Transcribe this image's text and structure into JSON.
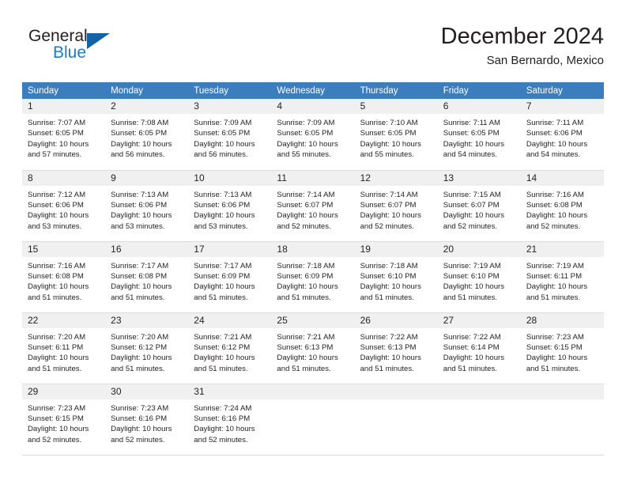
{
  "brand": {
    "general": "General",
    "blue": "Blue",
    "triangle_color": "#1362a4"
  },
  "header": {
    "month_title": "December 2024",
    "location": "San Bernardo, Mexico"
  },
  "theme": {
    "header_blue": "#3c7ebd",
    "daynum_gray": "#f0f0f0",
    "rule_blue": "#1362a4",
    "text": "#231f20"
  },
  "weekdays": [
    "Sunday",
    "Monday",
    "Tuesday",
    "Wednesday",
    "Thursday",
    "Friday",
    "Saturday"
  ],
  "weeks": [
    [
      {
        "day": "1",
        "sunrise": "Sunrise: 7:07 AM",
        "sunset": "Sunset: 6:05 PM",
        "daylight1": "Daylight: 10 hours",
        "daylight2": "and 57 minutes."
      },
      {
        "day": "2",
        "sunrise": "Sunrise: 7:08 AM",
        "sunset": "Sunset: 6:05 PM",
        "daylight1": "Daylight: 10 hours",
        "daylight2": "and 56 minutes."
      },
      {
        "day": "3",
        "sunrise": "Sunrise: 7:09 AM",
        "sunset": "Sunset: 6:05 PM",
        "daylight1": "Daylight: 10 hours",
        "daylight2": "and 56 minutes."
      },
      {
        "day": "4",
        "sunrise": "Sunrise: 7:09 AM",
        "sunset": "Sunset: 6:05 PM",
        "daylight1": "Daylight: 10 hours",
        "daylight2": "and 55 minutes."
      },
      {
        "day": "5",
        "sunrise": "Sunrise: 7:10 AM",
        "sunset": "Sunset: 6:05 PM",
        "daylight1": "Daylight: 10 hours",
        "daylight2": "and 55 minutes."
      },
      {
        "day": "6",
        "sunrise": "Sunrise: 7:11 AM",
        "sunset": "Sunset: 6:05 PM",
        "daylight1": "Daylight: 10 hours",
        "daylight2": "and 54 minutes."
      },
      {
        "day": "7",
        "sunrise": "Sunrise: 7:11 AM",
        "sunset": "Sunset: 6:06 PM",
        "daylight1": "Daylight: 10 hours",
        "daylight2": "and 54 minutes."
      }
    ],
    [
      {
        "day": "8",
        "sunrise": "Sunrise: 7:12 AM",
        "sunset": "Sunset: 6:06 PM",
        "daylight1": "Daylight: 10 hours",
        "daylight2": "and 53 minutes."
      },
      {
        "day": "9",
        "sunrise": "Sunrise: 7:13 AM",
        "sunset": "Sunset: 6:06 PM",
        "daylight1": "Daylight: 10 hours",
        "daylight2": "and 53 minutes."
      },
      {
        "day": "10",
        "sunrise": "Sunrise: 7:13 AM",
        "sunset": "Sunset: 6:06 PM",
        "daylight1": "Daylight: 10 hours",
        "daylight2": "and 53 minutes."
      },
      {
        "day": "11",
        "sunrise": "Sunrise: 7:14 AM",
        "sunset": "Sunset: 6:07 PM",
        "daylight1": "Daylight: 10 hours",
        "daylight2": "and 52 minutes."
      },
      {
        "day": "12",
        "sunrise": "Sunrise: 7:14 AM",
        "sunset": "Sunset: 6:07 PM",
        "daylight1": "Daylight: 10 hours",
        "daylight2": "and 52 minutes."
      },
      {
        "day": "13",
        "sunrise": "Sunrise: 7:15 AM",
        "sunset": "Sunset: 6:07 PM",
        "daylight1": "Daylight: 10 hours",
        "daylight2": "and 52 minutes."
      },
      {
        "day": "14",
        "sunrise": "Sunrise: 7:16 AM",
        "sunset": "Sunset: 6:08 PM",
        "daylight1": "Daylight: 10 hours",
        "daylight2": "and 52 minutes."
      }
    ],
    [
      {
        "day": "15",
        "sunrise": "Sunrise: 7:16 AM",
        "sunset": "Sunset: 6:08 PM",
        "daylight1": "Daylight: 10 hours",
        "daylight2": "and 51 minutes."
      },
      {
        "day": "16",
        "sunrise": "Sunrise: 7:17 AM",
        "sunset": "Sunset: 6:08 PM",
        "daylight1": "Daylight: 10 hours",
        "daylight2": "and 51 minutes."
      },
      {
        "day": "17",
        "sunrise": "Sunrise: 7:17 AM",
        "sunset": "Sunset: 6:09 PM",
        "daylight1": "Daylight: 10 hours",
        "daylight2": "and 51 minutes."
      },
      {
        "day": "18",
        "sunrise": "Sunrise: 7:18 AM",
        "sunset": "Sunset: 6:09 PM",
        "daylight1": "Daylight: 10 hours",
        "daylight2": "and 51 minutes."
      },
      {
        "day": "19",
        "sunrise": "Sunrise: 7:18 AM",
        "sunset": "Sunset: 6:10 PM",
        "daylight1": "Daylight: 10 hours",
        "daylight2": "and 51 minutes."
      },
      {
        "day": "20",
        "sunrise": "Sunrise: 7:19 AM",
        "sunset": "Sunset: 6:10 PM",
        "daylight1": "Daylight: 10 hours",
        "daylight2": "and 51 minutes."
      },
      {
        "day": "21",
        "sunrise": "Sunrise: 7:19 AM",
        "sunset": "Sunset: 6:11 PM",
        "daylight1": "Daylight: 10 hours",
        "daylight2": "and 51 minutes."
      }
    ],
    [
      {
        "day": "22",
        "sunrise": "Sunrise: 7:20 AM",
        "sunset": "Sunset: 6:11 PM",
        "daylight1": "Daylight: 10 hours",
        "daylight2": "and 51 minutes."
      },
      {
        "day": "23",
        "sunrise": "Sunrise: 7:20 AM",
        "sunset": "Sunset: 6:12 PM",
        "daylight1": "Daylight: 10 hours",
        "daylight2": "and 51 minutes."
      },
      {
        "day": "24",
        "sunrise": "Sunrise: 7:21 AM",
        "sunset": "Sunset: 6:12 PM",
        "daylight1": "Daylight: 10 hours",
        "daylight2": "and 51 minutes."
      },
      {
        "day": "25",
        "sunrise": "Sunrise: 7:21 AM",
        "sunset": "Sunset: 6:13 PM",
        "daylight1": "Daylight: 10 hours",
        "daylight2": "and 51 minutes."
      },
      {
        "day": "26",
        "sunrise": "Sunrise: 7:22 AM",
        "sunset": "Sunset: 6:13 PM",
        "daylight1": "Daylight: 10 hours",
        "daylight2": "and 51 minutes."
      },
      {
        "day": "27",
        "sunrise": "Sunrise: 7:22 AM",
        "sunset": "Sunset: 6:14 PM",
        "daylight1": "Daylight: 10 hours",
        "daylight2": "and 51 minutes."
      },
      {
        "day": "28",
        "sunrise": "Sunrise: 7:23 AM",
        "sunset": "Sunset: 6:15 PM",
        "daylight1": "Daylight: 10 hours",
        "daylight2": "and 51 minutes."
      }
    ],
    [
      {
        "day": "29",
        "sunrise": "Sunrise: 7:23 AM",
        "sunset": "Sunset: 6:15 PM",
        "daylight1": "Daylight: 10 hours",
        "daylight2": "and 52 minutes."
      },
      {
        "day": "30",
        "sunrise": "Sunrise: 7:23 AM",
        "sunset": "Sunset: 6:16 PM",
        "daylight1": "Daylight: 10 hours",
        "daylight2": "and 52 minutes."
      },
      {
        "day": "31",
        "sunrise": "Sunrise: 7:24 AM",
        "sunset": "Sunset: 6:16 PM",
        "daylight1": "Daylight: 10 hours",
        "daylight2": "and 52 minutes."
      },
      {
        "day": "",
        "sunrise": "",
        "sunset": "",
        "daylight1": "",
        "daylight2": ""
      },
      {
        "day": "",
        "sunrise": "",
        "sunset": "",
        "daylight1": "",
        "daylight2": ""
      },
      {
        "day": "",
        "sunrise": "",
        "sunset": "",
        "daylight1": "",
        "daylight2": ""
      },
      {
        "day": "",
        "sunrise": "",
        "sunset": "",
        "daylight1": "",
        "daylight2": ""
      }
    ]
  ]
}
